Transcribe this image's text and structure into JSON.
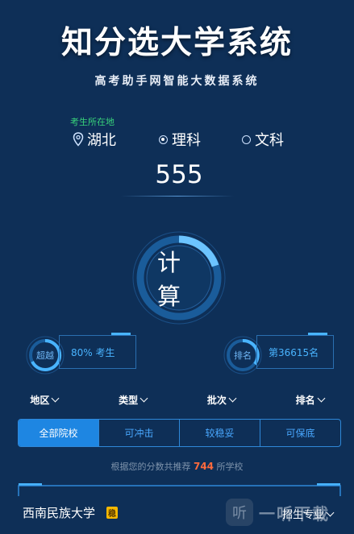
{
  "header": {
    "title": "知分选大学系统",
    "subtitle": "高考助手网智能大数据系统"
  },
  "form": {
    "province_caption": "考生所在地",
    "province": "湖北",
    "subjects": [
      {
        "label": "理科",
        "selected": true
      },
      {
        "label": "文科",
        "selected": false
      }
    ],
    "score": "555",
    "calculate_label": "计算"
  },
  "stats": {
    "beat": {
      "gauge_label": "超越",
      "text": "80% 考生"
    },
    "rank": {
      "gauge_label": "排名",
      "text": "第36615名"
    }
  },
  "filters": [
    "地区",
    "类型",
    "批次",
    "排名"
  ],
  "tabs": [
    {
      "label": "全部院校",
      "active": true
    },
    {
      "label": "可冲击",
      "active": false
    },
    {
      "label": "较稳妥",
      "active": false
    },
    {
      "label": "可保底",
      "active": false
    }
  ],
  "summary": {
    "prefix": "根据您的分数共推荐",
    "count": "744",
    "suffix": "所学校"
  },
  "result_card": {
    "school": "西南民族大学",
    "badge": "稳",
    "major_dropdown": "招生专业"
  },
  "watermark": {
    "text": "一听下载",
    "logo_char": "听"
  },
  "colors": {
    "background": "#0e2f57",
    "accent": "#1e86e2",
    "highlight": "#ff6a3d",
    "province_caption": "#38d27a",
    "badge": "#f5b800"
  }
}
